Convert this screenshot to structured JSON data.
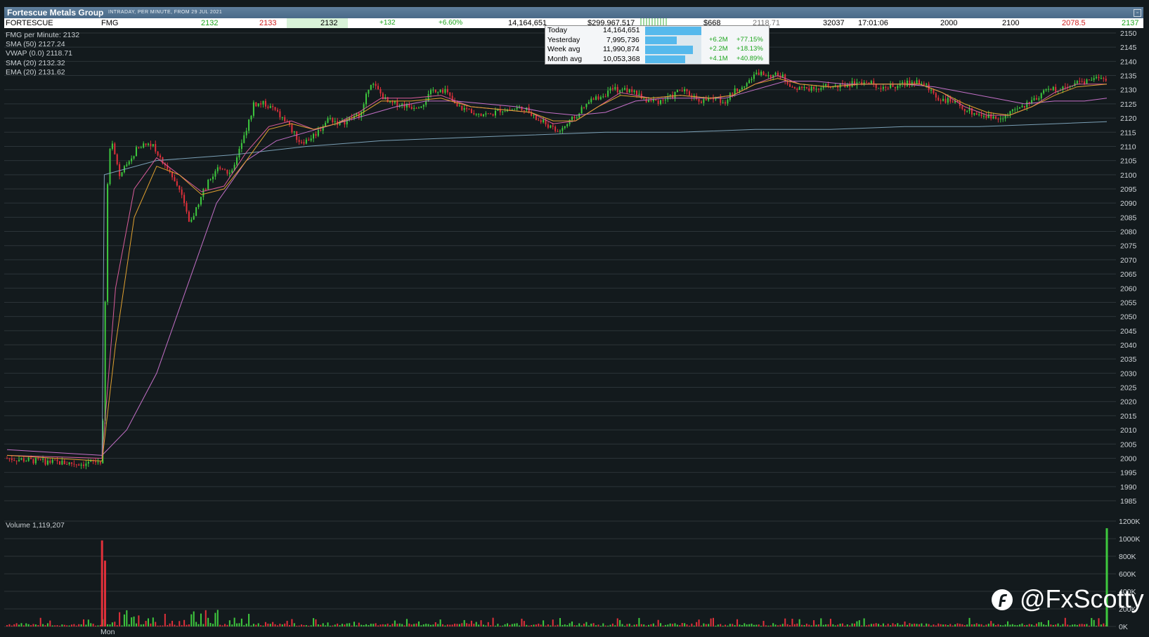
{
  "window": {
    "title": "Fortescue Metals Group",
    "subtitle": "INTRADAY, PER MINUTE, FROM 29 JUL 2021"
  },
  "quote": {
    "name": "FORTESCUE",
    "code": "FMG",
    "bid": "2132",
    "ask": "2133",
    "last": "2132",
    "change": "+132",
    "change_pct": "+6.60%",
    "volume": "14,164,651",
    "value": "$299,967,517",
    "trades": "$668",
    "vwap": "2118.71",
    "trade_count": "32037",
    "time": "17:01:06",
    "open": "2000",
    "high": "2100",
    "low": "2078.5",
    "close": "2137"
  },
  "legend": {
    "price": "FMG per Minute: 2132",
    "sma50": "SMA (50) 2127.24",
    "vwap": "VWAP (0.0) 2118.71",
    "sma20": "SMA (20) 2132.32",
    "ema20": "EMA (20) 2131.62"
  },
  "volume_popup": {
    "rows": [
      {
        "label": "Today",
        "value": "14,164,651",
        "fill": 1.0,
        "chg": "",
        "pct": ""
      },
      {
        "label": "Yesterday",
        "value": "7,995,736",
        "fill": 0.56,
        "chg": "+6.2M",
        "pct": "+77.15%"
      },
      {
        "label": "Week avg",
        "value": "11,990,874",
        "fill": 0.85,
        "chg": "+2.2M",
        "pct": "+18.13%"
      },
      {
        "label": "Month avg",
        "value": "10,053,368",
        "fill": 0.71,
        "chg": "+4.1M",
        "pct": "+40.89%"
      }
    ]
  },
  "volume_label": "Volume 1,119,207",
  "x_label": "Mon",
  "watermark": "@FxScotty",
  "colors": {
    "background": "#131a1d",
    "up": "#3ec93e",
    "down": "#e0303a",
    "sma50": "#c470c8",
    "vwap": "#7a9fb5",
    "ema20": "#e0a030",
    "grid": "#2c3438"
  },
  "chart_data": {
    "type": "candlestick",
    "price_axis": {
      "min": 1985,
      "max": 2150,
      "step": 5,
      "ticks": [
        2150,
        2145,
        2140,
        2135,
        2130,
        2125,
        2120,
        2115,
        2110,
        2105,
        2100,
        2095,
        2090,
        2085,
        2080,
        2075,
        2070,
        2065,
        2060,
        2055,
        2050,
        2045,
        2040,
        2035,
        2030,
        2025,
        2020,
        2015,
        2010,
        2005,
        2000,
        1995,
        1990,
        1985
      ]
    },
    "volume_axis": {
      "min": 0,
      "max": 1200000,
      "ticks": [
        "1200K",
        "1000K",
        "800K",
        "600K",
        "400K",
        "200K",
        "0K"
      ],
      "tick_values": [
        1200000,
        1000000,
        800000,
        600000,
        400000,
        200000,
        0
      ]
    },
    "price_path": [
      [
        0,
        2000
      ],
      [
        40,
        1999
      ],
      [
        100,
        1998
      ],
      [
        127,
        1999
      ],
      [
        135,
        2105
      ],
      [
        140,
        2113
      ],
      [
        150,
        2100
      ],
      [
        160,
        2103
      ],
      [
        175,
        2110
      ],
      [
        190,
        2112
      ],
      [
        200,
        2108
      ],
      [
        215,
        2102
      ],
      [
        230,
        2095
      ],
      [
        245,
        2082
      ],
      [
        255,
        2090
      ],
      [
        270,
        2098
      ],
      [
        285,
        2103
      ],
      [
        300,
        2100
      ],
      [
        315,
        2112
      ],
      [
        330,
        2125
      ],
      [
        345,
        2125
      ],
      [
        360,
        2122
      ],
      [
        375,
        2118
      ],
      [
        390,
        2112
      ],
      [
        400,
        2112
      ],
      [
        415,
        2115
      ],
      [
        430,
        2120
      ],
      [
        445,
        2118
      ],
      [
        460,
        2120
      ],
      [
        475,
        2122
      ],
      [
        485,
        2133
      ],
      [
        495,
        2130
      ],
      [
        510,
        2125
      ],
      [
        525,
        2125
      ],
      [
        540,
        2124
      ],
      [
        555,
        2125
      ],
      [
        570,
        2130
      ],
      [
        585,
        2130
      ],
      [
        600,
        2124
      ],
      [
        615,
        2123
      ],
      [
        630,
        2122
      ],
      [
        645,
        2121
      ],
      [
        660,
        2123
      ],
      [
        675,
        2123
      ],
      [
        690,
        2124
      ],
      [
        705,
        2120
      ],
      [
        720,
        2118
      ],
      [
        735,
        2115
      ],
      [
        750,
        2118
      ],
      [
        765,
        2122
      ],
      [
        780,
        2126
      ],
      [
        795,
        2128
      ],
      [
        810,
        2130
      ],
      [
        825,
        2130
      ],
      [
        840,
        2129
      ],
      [
        855,
        2126
      ],
      [
        870,
        2126
      ],
      [
        885,
        2127
      ],
      [
        900,
        2130
      ],
      [
        915,
        2128
      ],
      [
        930,
        2126
      ],
      [
        945,
        2127
      ],
      [
        960,
        2126
      ],
      [
        975,
        2130
      ],
      [
        990,
        2133
      ],
      [
        1005,
        2136
      ],
      [
        1020,
        2135
      ],
      [
        1035,
        2135
      ],
      [
        1050,
        2131
      ],
      [
        1065,
        2130
      ],
      [
        1080,
        2131
      ],
      [
        1095,
        2131
      ],
      [
        1110,
        2131
      ],
      [
        1125,
        2132
      ],
      [
        1140,
        2133
      ],
      [
        1155,
        2132
      ],
      [
        1170,
        2131
      ],
      [
        1185,
        2131
      ],
      [
        1200,
        2132
      ],
      [
        1215,
        2133
      ],
      [
        1230,
        2131
      ],
      [
        1245,
        2127
      ],
      [
        1260,
        2126
      ],
      [
        1275,
        2124
      ],
      [
        1290,
        2122
      ],
      [
        1305,
        2121
      ],
      [
        1320,
        2120
      ],
      [
        1335,
        2121
      ],
      [
        1350,
        2123
      ],
      [
        1365,
        2125
      ],
      [
        1380,
        2128
      ],
      [
        1395,
        2130
      ],
      [
        1410,
        2131
      ],
      [
        1425,
        2132
      ],
      [
        1440,
        2133
      ],
      [
        1455,
        2135
      ],
      [
        1465,
        2134
      ],
      [
        1470,
        2132
      ]
    ],
    "sma50_path": [
      [
        0,
        2003
      ],
      [
        127,
        2001
      ],
      [
        160,
        2010
      ],
      [
        200,
        2030
      ],
      [
        240,
        2060
      ],
      [
        280,
        2090
      ],
      [
        320,
        2105
      ],
      [
        360,
        2112
      ],
      [
        400,
        2115
      ],
      [
        440,
        2118
      ],
      [
        480,
        2121
      ],
      [
        520,
        2124
      ],
      [
        560,
        2126
      ],
      [
        600,
        2126
      ],
      [
        640,
        2125
      ],
      [
        680,
        2124
      ],
      [
        720,
        2122
      ],
      [
        760,
        2121
      ],
      [
        800,
        2122
      ],
      [
        840,
        2126
      ],
      [
        880,
        2127
      ],
      [
        920,
        2127
      ],
      [
        960,
        2127
      ],
      [
        1000,
        2130
      ],
      [
        1040,
        2133
      ],
      [
        1080,
        2133
      ],
      [
        1120,
        2132
      ],
      [
        1160,
        2132
      ],
      [
        1200,
        2132
      ],
      [
        1240,
        2131
      ],
      [
        1280,
        2129
      ],
      [
        1320,
        2127
      ],
      [
        1360,
        2125
      ],
      [
        1400,
        2126
      ],
      [
        1440,
        2126
      ],
      [
        1470,
        2127
      ]
    ],
    "ema20_path": [
      [
        0,
        2001
      ],
      [
        127,
        1999
      ],
      [
        145,
        2040
      ],
      [
        170,
        2085
      ],
      [
        200,
        2103
      ],
      [
        230,
        2100
      ],
      [
        260,
        2093
      ],
      [
        290,
        2095
      ],
      [
        320,
        2105
      ],
      [
        350,
        2116
      ],
      [
        380,
        2118
      ],
      [
        410,
        2116
      ],
      [
        440,
        2118
      ],
      [
        470,
        2121
      ],
      [
        500,
        2126
      ],
      [
        540,
        2126
      ],
      [
        580,
        2127
      ],
      [
        620,
        2124
      ],
      [
        660,
        2123
      ],
      [
        700,
        2122
      ],
      [
        730,
        2119
      ],
      [
        760,
        2119
      ],
      [
        790,
        2124
      ],
      [
        820,
        2128
      ],
      [
        860,
        2127
      ],
      [
        900,
        2128
      ],
      [
        940,
        2127
      ],
      [
        970,
        2128
      ],
      [
        1000,
        2132
      ],
      [
        1030,
        2134
      ],
      [
        1060,
        2132
      ],
      [
        1100,
        2131
      ],
      [
        1140,
        2132
      ],
      [
        1180,
        2132
      ],
      [
        1220,
        2132
      ],
      [
        1250,
        2129
      ],
      [
        1280,
        2125
      ],
      [
        1310,
        2122
      ],
      [
        1340,
        2121
      ],
      [
        1370,
        2124
      ],
      [
        1400,
        2128
      ],
      [
        1430,
        2131
      ],
      [
        1470,
        2132
      ]
    ],
    "sma20_path": [
      [
        0,
        2001
      ],
      [
        127,
        2000
      ],
      [
        145,
        2060
      ],
      [
        170,
        2095
      ],
      [
        200,
        2106
      ],
      [
        230,
        2100
      ],
      [
        260,
        2094
      ],
      [
        290,
        2096
      ],
      [
        320,
        2108
      ],
      [
        350,
        2117
      ],
      [
        380,
        2119
      ],
      [
        410,
        2116
      ],
      [
        440,
        2118
      ],
      [
        470,
        2122
      ],
      [
        500,
        2127
      ],
      [
        540,
        2127
      ],
      [
        580,
        2128
      ],
      [
        620,
        2124
      ],
      [
        660,
        2123
      ],
      [
        700,
        2122
      ],
      [
        730,
        2118
      ],
      [
        760,
        2119
      ],
      [
        790,
        2124
      ],
      [
        820,
        2129
      ],
      [
        860,
        2127
      ],
      [
        900,
        2128
      ],
      [
        940,
        2127
      ],
      [
        970,
        2128
      ],
      [
        1000,
        2132
      ],
      [
        1030,
        2135
      ],
      [
        1060,
        2132
      ],
      [
        1100,
        2131
      ],
      [
        1140,
        2132
      ],
      [
        1180,
        2132
      ],
      [
        1220,
        2132
      ],
      [
        1250,
        2129
      ],
      [
        1280,
        2124
      ],
      [
        1310,
        2121
      ],
      [
        1340,
        2121
      ],
      [
        1370,
        2124
      ],
      [
        1400,
        2129
      ],
      [
        1430,
        2132
      ],
      [
        1470,
        2132
      ]
    ],
    "vwap_path": [
      [
        127,
        2000
      ],
      [
        130,
        2100
      ],
      [
        200,
        2105
      ],
      [
        300,
        2107
      ],
      [
        400,
        2110
      ],
      [
        500,
        2112
      ],
      [
        600,
        2113
      ],
      [
        700,
        2114
      ],
      [
        800,
        2115
      ],
      [
        900,
        2115
      ],
      [
        1000,
        2116
      ],
      [
        1100,
        2116
      ],
      [
        1200,
        2117
      ],
      [
        1300,
        2117
      ],
      [
        1400,
        2118
      ],
      [
        1470,
        2118.7
      ]
    ],
    "volume_spikes": [
      {
        "t": 127,
        "v": 980000
      },
      {
        "t": 131,
        "v": 750000
      },
      {
        "t": 1470,
        "v": 1119207
      }
    ]
  }
}
